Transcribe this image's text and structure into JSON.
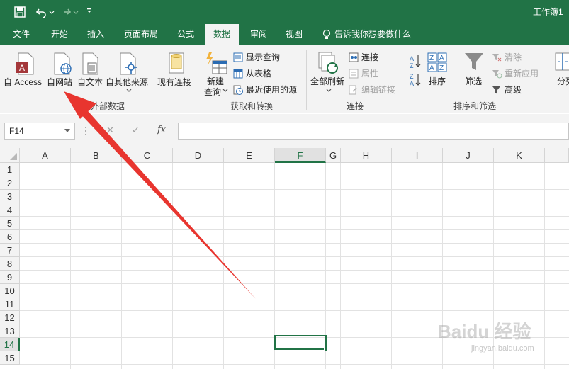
{
  "title": "工作簿1",
  "colors": {
    "brand": "#217346",
    "arrow": "#e8352f"
  },
  "qat": {
    "save_icon": "save-icon",
    "undo_icon": "undo-icon",
    "redo_icon": "redo-icon",
    "customize_icon": "customize-qat-icon"
  },
  "tabs": [
    "文件",
    "开始",
    "插入",
    "页面布局",
    "公式",
    "数据",
    "审阅",
    "视图"
  ],
  "active_tab": "数据",
  "tell_me": "告诉我你想要做什么",
  "ribbon": {
    "get_external": {
      "label": "获取外部数据",
      "from_access": "自 Access",
      "from_web": "自网站",
      "from_text": "自文本",
      "from_other": "自其他来源",
      "existing_connections": "现有连接"
    },
    "get_transform": {
      "label": "获取和转换",
      "new_query_line1": "新建",
      "new_query_line2": "查询",
      "show_queries": "显示查询",
      "from_table": "从表格",
      "recent_sources": "最近使用的源"
    },
    "connections": {
      "label": "连接",
      "refresh_all": "全部刷新",
      "connections": "连接",
      "properties": "属性",
      "edit_links": "编辑链接"
    },
    "sort_filter": {
      "label": "排序和筛选",
      "sort": "排序",
      "filter": "筛选",
      "clear": "清除",
      "reapply": "重新应用",
      "advanced": "高级"
    },
    "data_tools": {
      "split": "分列"
    }
  },
  "formula_bar": {
    "name_box": "F14",
    "cancel": "✕",
    "enter": "✓",
    "fx": "fx",
    "value": ""
  },
  "sheet": {
    "columns": [
      "A",
      "B",
      "C",
      "D",
      "E",
      "F",
      "G",
      "H",
      "I",
      "J",
      "K"
    ],
    "rows": [
      "1",
      "2",
      "3",
      "4",
      "5",
      "6",
      "7",
      "8",
      "9",
      "10",
      "11",
      "12",
      "13",
      "14",
      "15"
    ],
    "selected_cell": "F14"
  },
  "watermark": {
    "brand": "Baidu 经验",
    "url": "jingyan.baidu.com"
  }
}
